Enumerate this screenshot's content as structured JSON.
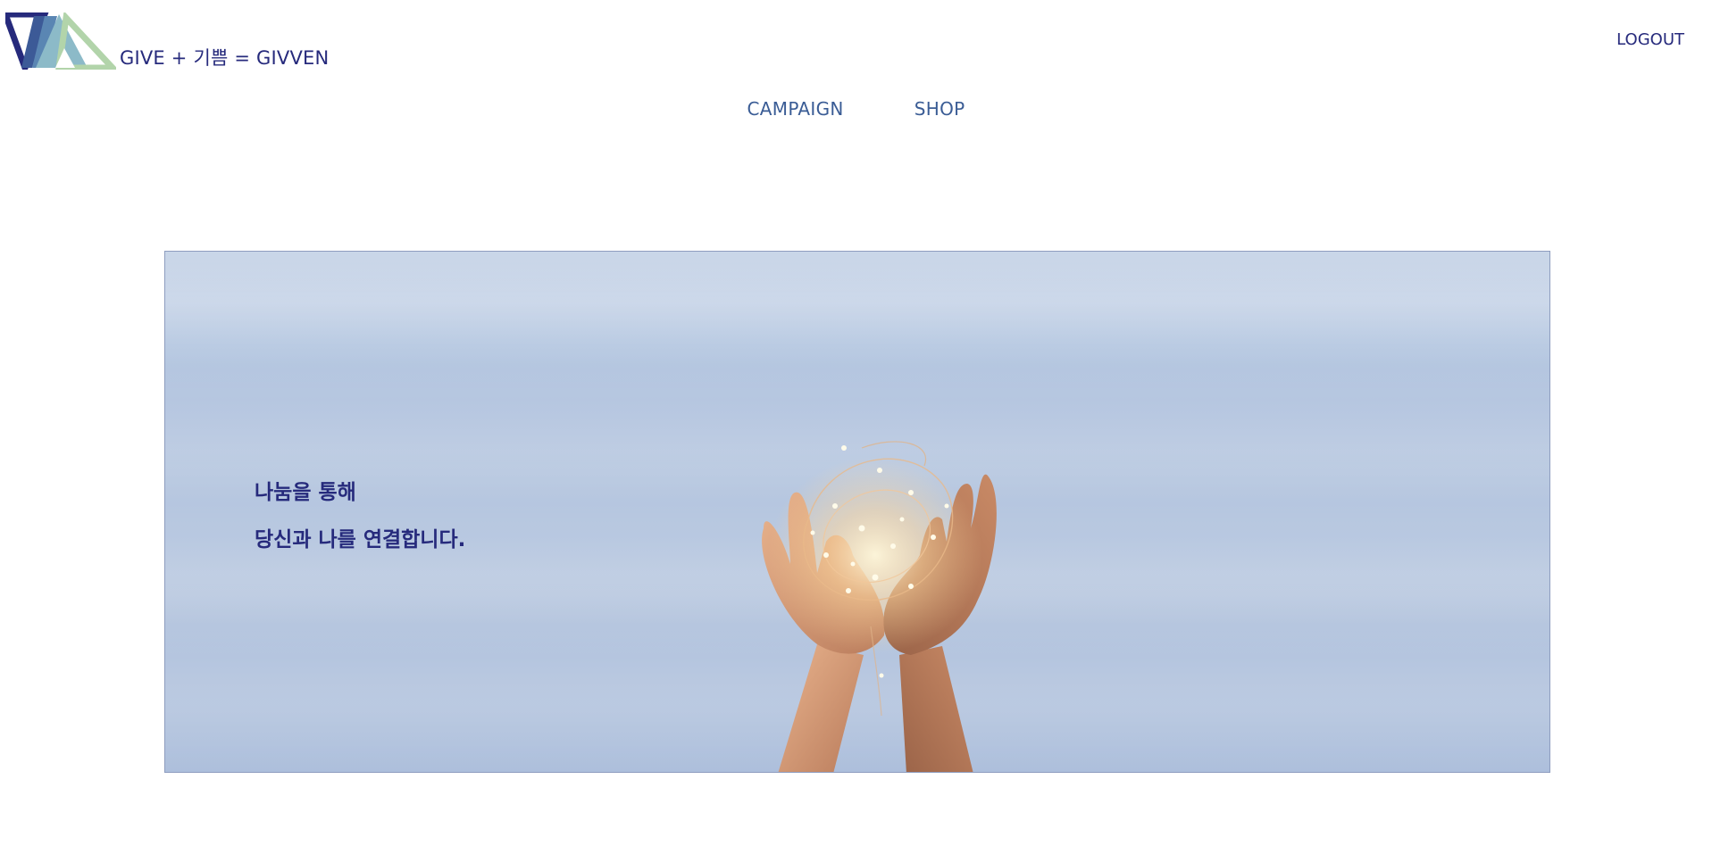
{
  "header": {
    "logo_text": "GIVE + 기쁨 = GIVVEN",
    "logout_label": "LOGOUT"
  },
  "nav": {
    "items": [
      {
        "label": "CAMPAIGN"
      },
      {
        "label": "SHOP"
      }
    ]
  },
  "hero": {
    "line1": "나눔을 통해",
    "line2": "당신과 나를 연결합니다."
  },
  "colors": {
    "brand_navy": "#262a7c",
    "nav_blue": "#3a5c95",
    "logo_teal": "#5f9cb4",
    "logo_green": "#a9cfa6",
    "hero_sky": "#b6c8e1"
  }
}
